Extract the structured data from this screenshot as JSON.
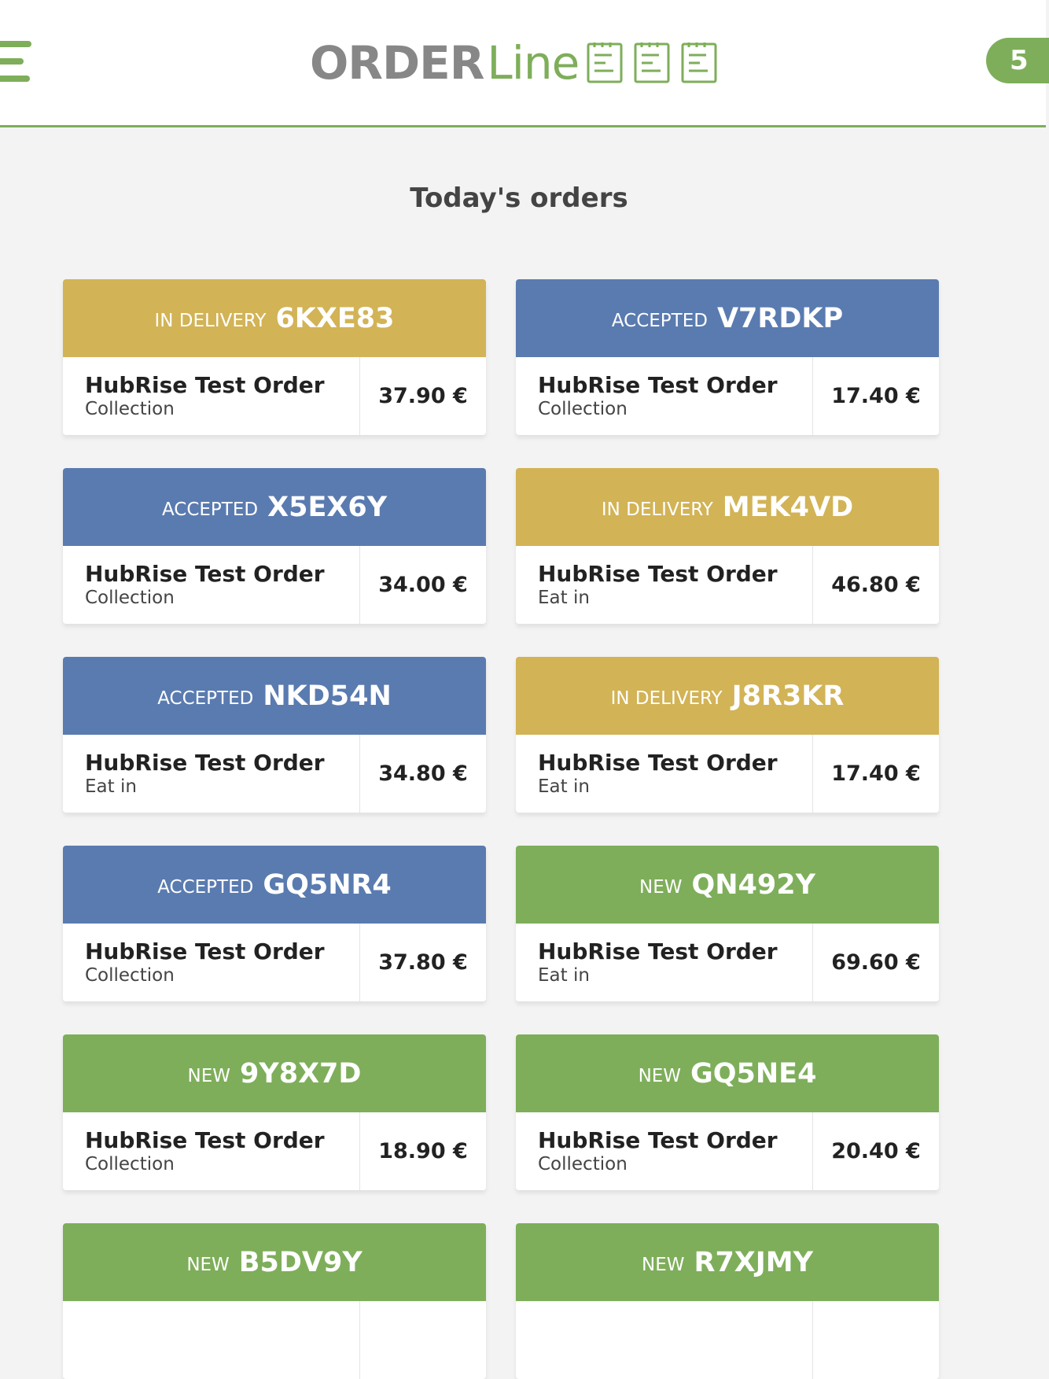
{
  "header": {
    "logo_order": "ORDER",
    "logo_line": "Line",
    "count_badge": "5"
  },
  "colors": {
    "accent": "#7eae5a",
    "in_delivery": "#d2b356",
    "accepted": "#5a7bb0",
    "new": "#7eae5a"
  },
  "page_title": "Today's orders",
  "orders": [
    {
      "status": "IN DELIVERY",
      "status_key": "in_delivery",
      "code": "6KXE83",
      "name": "HubRise Test Order",
      "type": "Collection",
      "price": "37.90 €"
    },
    {
      "status": "ACCEPTED",
      "status_key": "accepted",
      "code": "V7RDKP",
      "name": "HubRise Test Order",
      "type": "Collection",
      "price": "17.40 €"
    },
    {
      "status": "ACCEPTED",
      "status_key": "accepted",
      "code": "X5EX6Y",
      "name": "HubRise Test Order",
      "type": "Collection",
      "price": "34.00 €"
    },
    {
      "status": "IN DELIVERY",
      "status_key": "in_delivery",
      "code": "MEK4VD",
      "name": "HubRise Test Order",
      "type": "Eat in",
      "price": "46.80 €"
    },
    {
      "status": "ACCEPTED",
      "status_key": "accepted",
      "code": "NKD54N",
      "name": "HubRise Test Order",
      "type": "Eat in",
      "price": "34.80 €"
    },
    {
      "status": "IN DELIVERY",
      "status_key": "in_delivery",
      "code": "J8R3KR",
      "name": "HubRise Test Order",
      "type": "Eat in",
      "price": "17.40 €"
    },
    {
      "status": "ACCEPTED",
      "status_key": "accepted",
      "code": "GQ5NR4",
      "name": "HubRise Test Order",
      "type": "Collection",
      "price": "37.80 €"
    },
    {
      "status": "NEW",
      "status_key": "new",
      "code": "QN492Y",
      "name": "HubRise Test Order",
      "type": "Eat in",
      "price": "69.60 €"
    },
    {
      "status": "NEW",
      "status_key": "new",
      "code": "9Y8X7D",
      "name": "HubRise Test Order",
      "type": "Collection",
      "price": "18.90 €"
    },
    {
      "status": "NEW",
      "status_key": "new",
      "code": "GQ5NE4",
      "name": "HubRise Test Order",
      "type": "Collection",
      "price": "20.40 €"
    },
    {
      "status": "NEW",
      "status_key": "new",
      "code": "B5DV9Y",
      "name": "",
      "type": "",
      "price": ""
    },
    {
      "status": "NEW",
      "status_key": "new",
      "code": "R7XJMY",
      "name": "",
      "type": "",
      "price": ""
    }
  ]
}
